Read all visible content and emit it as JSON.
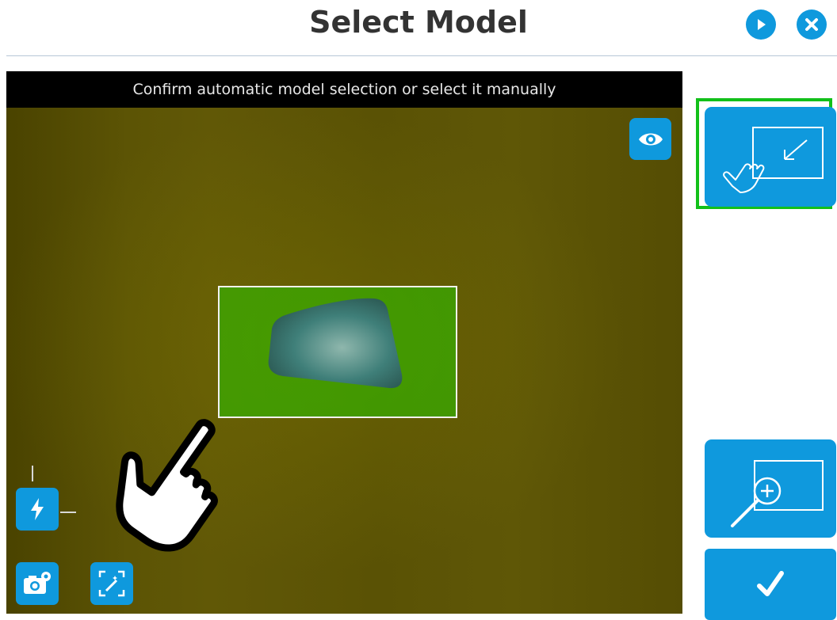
{
  "header": {
    "title": "Select Model",
    "play_icon": "play-icon",
    "close_icon": "close-icon"
  },
  "camera": {
    "banner_text": "Confirm automatic model selection or select it manually",
    "eye_icon": "eye-icon",
    "roi_label": "detected-model-region"
  },
  "tools": {
    "flash_icon": "flash-icon",
    "camera_settings_icon": "camera-settings-icon",
    "auto_select_icon": "magic-wand-icon"
  },
  "side": {
    "manual_select_icon": "hand-select-icon",
    "zoom_icon": "zoom-in-icon",
    "confirm_icon": "checkmark-icon"
  },
  "colors": {
    "accent": "#0f99dd",
    "selected_border": "#12c01a",
    "title": "#333333"
  }
}
